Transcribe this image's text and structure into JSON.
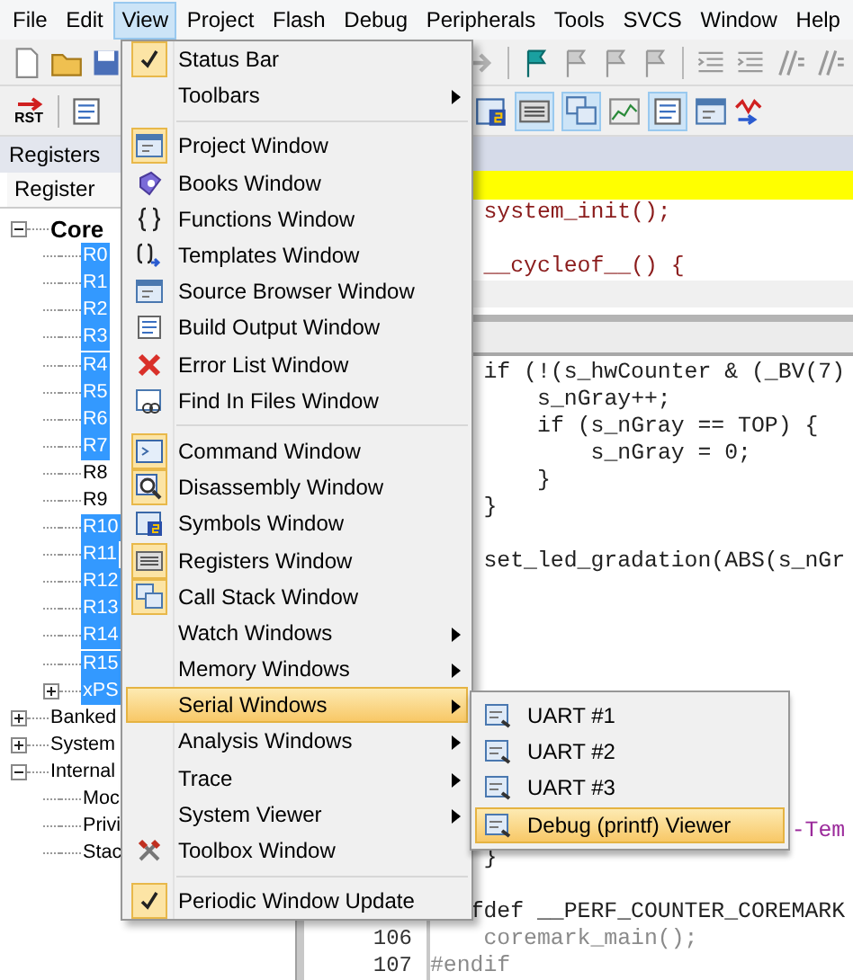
{
  "menubar": [
    {
      "label": "File",
      "selected": false
    },
    {
      "label": "Edit",
      "selected": false
    },
    {
      "label": "View",
      "selected": true
    },
    {
      "label": "Project",
      "selected": false
    },
    {
      "label": "Flash",
      "selected": false
    },
    {
      "label": "Debug",
      "selected": false
    },
    {
      "label": "Peripherals",
      "selected": false
    },
    {
      "label": "Tools",
      "selected": false
    },
    {
      "label": "SVCS",
      "selected": false
    },
    {
      "label": "Window",
      "selected": false
    },
    {
      "label": "Help",
      "selected": false
    }
  ],
  "toolbar": {
    "reset_label": "RST"
  },
  "registers_panel": {
    "title": "Registers",
    "column_header": "Register",
    "tree": [
      {
        "label": "Core",
        "emphasized": true,
        "expanded": true,
        "selected": false,
        "children": [
          {
            "label": "R0",
            "selected": true
          },
          {
            "label": "R1",
            "selected": true
          },
          {
            "label": "R2",
            "selected": true
          },
          {
            "label": "R3",
            "selected": true
          },
          {
            "label": "R4",
            "selected": true
          },
          {
            "label": "R5",
            "selected": true
          },
          {
            "label": "R6",
            "selected": true
          },
          {
            "label": "R7",
            "selected": true
          },
          {
            "label": "R8",
            "selected": false
          },
          {
            "label": "R9",
            "selected": false
          },
          {
            "label": "R10",
            "selected": true
          },
          {
            "label": "R11",
            "selected": true
          },
          {
            "label": "R12",
            "selected": true
          },
          {
            "label": "R13",
            "selected": true
          },
          {
            "label": "R14",
            "selected": true
          },
          {
            "label": "R15",
            "selected": true
          },
          {
            "label": "xPS",
            "selected": true,
            "expanded": false
          }
        ]
      },
      {
        "label": "Banked",
        "emphasized": false,
        "expanded": false,
        "selected": false
      },
      {
        "label": "System",
        "emphasized": false,
        "expanded": false,
        "selected": false
      },
      {
        "label": "Internal",
        "emphasized": false,
        "expanded": true,
        "selected": false,
        "children": [
          {
            "label": "Moc",
            "selected": false
          },
          {
            "label": "Privi",
            "selected": false
          },
          {
            "label": "Stac",
            "selected": false
          }
        ]
      }
    ]
  },
  "editor": {
    "top_pane": [
      {
        "kind": "call",
        "text": "    system_init();"
      },
      {
        "kind": "blank"
      },
      {
        "kind": "call",
        "text": "    __cycleof__() {"
      }
    ],
    "bottom_pane": [
      {
        "kind": "plain",
        "text": "    if (!(s_hwCounter & (_BV(7)"
      },
      {
        "kind": "plain",
        "text": "        s_nGray++;"
      },
      {
        "kind": "plain",
        "text": "        if (s_nGray == TOP) {"
      },
      {
        "kind": "plain",
        "text": "            s_nGray = 0;"
      },
      {
        "kind": "plain",
        "text": "        }"
      },
      {
        "kind": "plain",
        "text": "    }"
      },
      {
        "kind": "blank"
      },
      {
        "kind": "plain",
        "text": "    set_led_gradation(ABS(s_nGr"
      },
      {
        "kind": "blank"
      },
      {
        "kind": "blank"
      },
      {
        "kind": "blank"
      },
      {
        "kind": "blank"
      },
      {
        "kind": "blank"
      },
      {
        "kind": "blank"
      },
      {
        "kind": "blank"
      },
      {
        "kind": "blank"
      },
      {
        "kind": "blank"
      },
      {
        "kind": "string",
        "text": "                           -Tem"
      },
      {
        "kind": "plain",
        "text": "    }"
      },
      {
        "kind": "blank"
      },
      {
        "kind": "plain",
        "text": "   fdef __PERF_COUNTER_COREMARK"
      },
      {
        "kind": "inactive",
        "text": "    coremark_main();",
        "line_number": "106"
      },
      {
        "kind": "inactive",
        "text": "#endif",
        "line_number": "107"
      }
    ]
  },
  "view_menu": {
    "items": [
      {
        "kind": "item",
        "label": "Status Bar",
        "checked": true,
        "on": false,
        "submenu": false,
        "selected": false
      },
      {
        "kind": "item",
        "label": "Toolbars",
        "checked": false,
        "on": false,
        "submenu": true,
        "selected": false
      },
      {
        "kind": "separator"
      },
      {
        "kind": "item",
        "label": "Project Window",
        "checked": false,
        "on": true,
        "submenu": false,
        "selected": false
      },
      {
        "kind": "item",
        "label": "Books Window",
        "checked": false,
        "on": false,
        "submenu": false,
        "selected": false
      },
      {
        "kind": "item",
        "label": "Functions Window",
        "checked": false,
        "on": false,
        "submenu": false,
        "selected": false
      },
      {
        "kind": "item",
        "label": "Templates Window",
        "checked": false,
        "on": false,
        "submenu": false,
        "selected": false
      },
      {
        "kind": "item",
        "label": "Source Browser Window",
        "checked": false,
        "on": false,
        "submenu": false,
        "selected": false
      },
      {
        "kind": "item",
        "label": "Build Output Window",
        "checked": false,
        "on": false,
        "submenu": false,
        "selected": false
      },
      {
        "kind": "item",
        "label": "Error List Window",
        "checked": false,
        "on": false,
        "submenu": false,
        "selected": false
      },
      {
        "kind": "item",
        "label": "Find In Files Window",
        "checked": false,
        "on": false,
        "submenu": false,
        "selected": false
      },
      {
        "kind": "separator"
      },
      {
        "kind": "item",
        "label": "Command Window",
        "checked": false,
        "on": true,
        "submenu": false,
        "selected": false
      },
      {
        "kind": "item",
        "label": "Disassembly Window",
        "checked": false,
        "on": true,
        "submenu": false,
        "selected": false
      },
      {
        "kind": "item",
        "label": "Symbols Window",
        "checked": false,
        "on": false,
        "submenu": false,
        "selected": false
      },
      {
        "kind": "item",
        "label": "Registers Window",
        "checked": false,
        "on": true,
        "submenu": false,
        "selected": false
      },
      {
        "kind": "item",
        "label": "Call Stack Window",
        "checked": false,
        "on": true,
        "submenu": false,
        "selected": false
      },
      {
        "kind": "item",
        "label": "Watch Windows",
        "checked": false,
        "on": false,
        "submenu": true,
        "selected": false
      },
      {
        "kind": "item",
        "label": "Memory Windows",
        "checked": false,
        "on": false,
        "submenu": true,
        "selected": false
      },
      {
        "kind": "item",
        "label": "Serial Windows",
        "checked": false,
        "on": false,
        "submenu": true,
        "selected": true
      },
      {
        "kind": "item",
        "label": "Analysis Windows",
        "checked": false,
        "on": false,
        "submenu": true,
        "selected": false
      },
      {
        "kind": "item",
        "label": "Trace",
        "checked": false,
        "on": false,
        "submenu": true,
        "selected": false
      },
      {
        "kind": "item",
        "label": "System Viewer",
        "checked": false,
        "on": false,
        "submenu": true,
        "selected": false
      },
      {
        "kind": "item",
        "label": "Toolbox Window",
        "checked": false,
        "on": false,
        "submenu": false,
        "selected": false
      },
      {
        "kind": "separator"
      },
      {
        "kind": "item",
        "label": "Periodic Window Update",
        "checked": true,
        "on": false,
        "submenu": false,
        "selected": false
      }
    ]
  },
  "serial_submenu": {
    "items": [
      {
        "label": "UART #1",
        "selected": false
      },
      {
        "label": "UART #2",
        "selected": false
      },
      {
        "label": "UART #3",
        "selected": false
      },
      {
        "label": "Debug (printf) Viewer",
        "selected": true
      }
    ]
  }
}
